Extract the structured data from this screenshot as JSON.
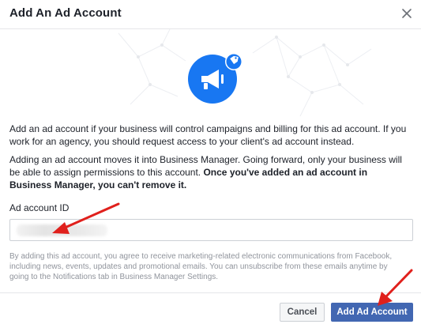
{
  "dialog": {
    "title": "Add An Ad Account",
    "close_label": "×"
  },
  "intro": {
    "paragraph1": "Add an ad account if your business will control campaigns and billing for this ad account. If you work for an agency, you should request access to your client's ad account instead.",
    "paragraph2_plain": "Adding an ad account moves it into Business Manager. Going forward, only your business will be able to assign permissions to this account. ",
    "paragraph2_bold": "Once you've added an ad account in Business Manager, you can't remove it."
  },
  "form": {
    "ad_account_label": "Ad account ID",
    "ad_account_value": ""
  },
  "disclaimer": "By adding this ad account, you agree to receive marketing-related electronic communications from Facebook, including news, events, updates and promotional emails. You can unsubscribe from these emails anytime by going to the Notifications tab in Business Manager Settings.",
  "footer": {
    "cancel_label": "Cancel",
    "submit_label": "Add Ad Account"
  },
  "colors": {
    "accent": "#1877f2",
    "primary_button": "#4267b2",
    "annotation_arrow": "#e0201c"
  },
  "icons": {
    "hero": "megaphone-icon",
    "badge": "tag-icon",
    "close": "close-icon"
  }
}
